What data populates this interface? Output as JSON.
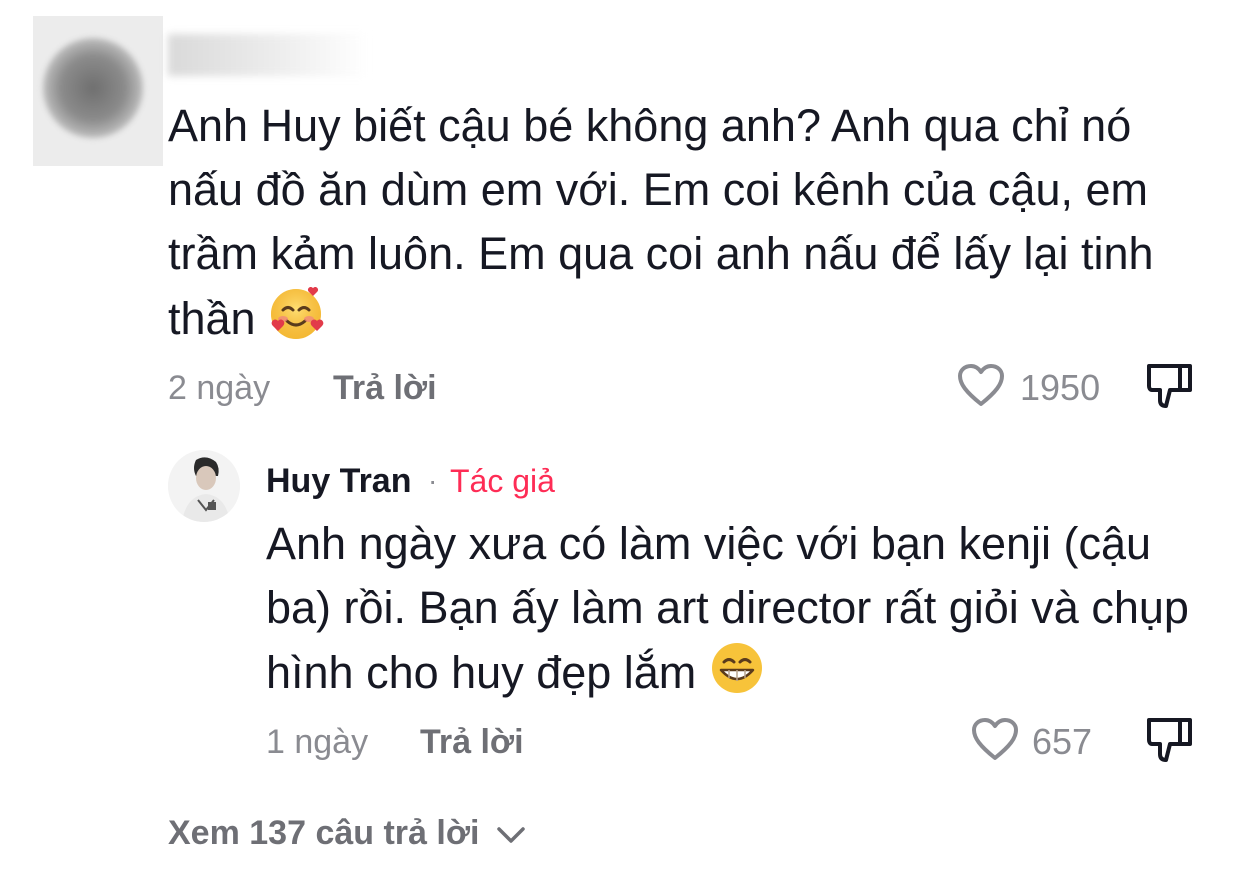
{
  "comment": {
    "text": "Anh Huy biết cậu bé không anh? Anh qua chỉ nó nấu đồ ăn dùm em với. Em coi kênh của cậu, em trầm kảm luôn. Em qua coi anh nấu để lấy lại tinh thần",
    "emoji": "smiling-face-with-hearts-icon",
    "time": "2 ngày",
    "reply_label": "Trả lời",
    "likes": "1950"
  },
  "reply": {
    "author": "Huy Tran",
    "separator": "·",
    "badge": "Tác giả",
    "text": "Anh ngày xưa có làm việc với bạn kenji (cậu ba) rồi. Bạn ấy làm art director rất giỏi và chụp hình cho huy đẹp lắm",
    "emoji": "grinning-face-icon",
    "time": "1 ngày",
    "reply_label": "Trả lời",
    "likes": "657"
  },
  "view_more": "Xem 137 câu trả lời",
  "colors": {
    "author_badge": "#fe2c55",
    "text": "#161823",
    "muted": "#8a8b91"
  }
}
